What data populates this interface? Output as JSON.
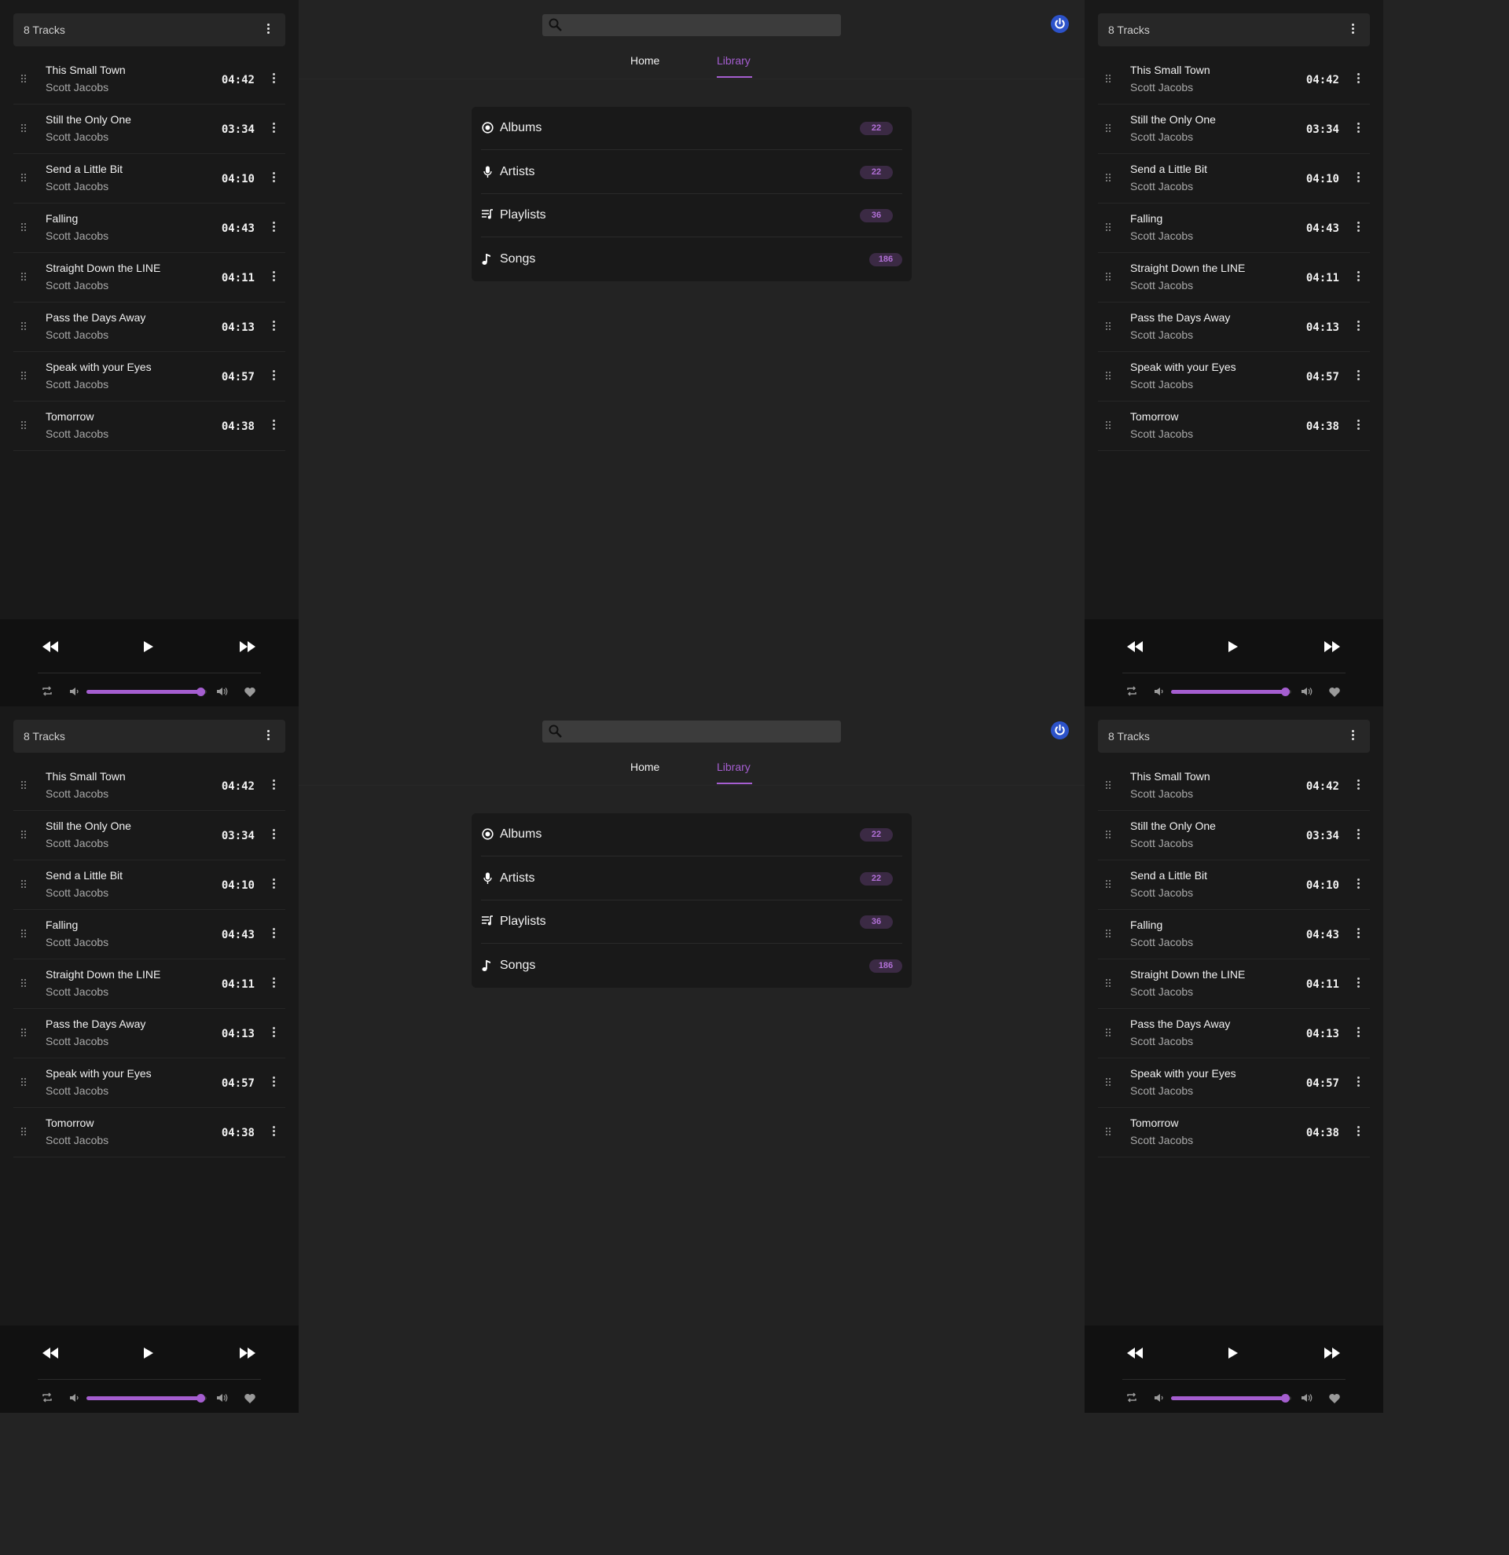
{
  "panel": {
    "title": "8 Tracks",
    "tracks": [
      {
        "title": "This Small Town",
        "artist": "Scott Jacobs",
        "duration": "04:42"
      },
      {
        "title": "Still the Only One",
        "artist": "Scott Jacobs",
        "duration": "03:34"
      },
      {
        "title": "Send a Little Bit",
        "artist": "Scott Jacobs",
        "duration": "04:10"
      },
      {
        "title": "Falling",
        "artist": "Scott Jacobs",
        "duration": "04:43"
      },
      {
        "title": "Straight Down the LINE",
        "artist": "Scott Jacobs",
        "duration": "04:11"
      },
      {
        "title": "Pass the Days Away",
        "artist": "Scott Jacobs",
        "duration": "04:13"
      },
      {
        "title": "Speak with your Eyes",
        "artist": "Scott Jacobs",
        "duration": "04:57"
      },
      {
        "title": "Tomorrow",
        "artist": "Scott Jacobs",
        "duration": "04:38"
      }
    ]
  },
  "player": {
    "volume_fraction": 0.95,
    "icons": {
      "prev": "rewind-icon",
      "play": "play-icon",
      "next": "fast-forward-icon",
      "repeat": "repeat-icon",
      "volume_low": "volume-low-icon",
      "volume_high": "volume-high-icon",
      "favorite": "heart-icon"
    }
  },
  "header": {
    "search_placeholder": "",
    "power_icon": "power-icon"
  },
  "nav": {
    "tabs": [
      {
        "label": "Home",
        "active": false
      },
      {
        "label": "Library",
        "active": true
      }
    ]
  },
  "library": {
    "items": [
      {
        "label": "Albums",
        "count": "22",
        "icon": "album-icon"
      },
      {
        "label": "Artists",
        "count": "22",
        "icon": "microphone-icon"
      },
      {
        "label": "Playlists",
        "count": "36",
        "icon": "playlist-icon"
      },
      {
        "label": "Songs",
        "count": "186",
        "icon": "music-note-icon"
      }
    ]
  },
  "colors": {
    "accent": "#a55ed0",
    "power": "#2c52c9",
    "background": "#232323",
    "panel": "#191919"
  }
}
